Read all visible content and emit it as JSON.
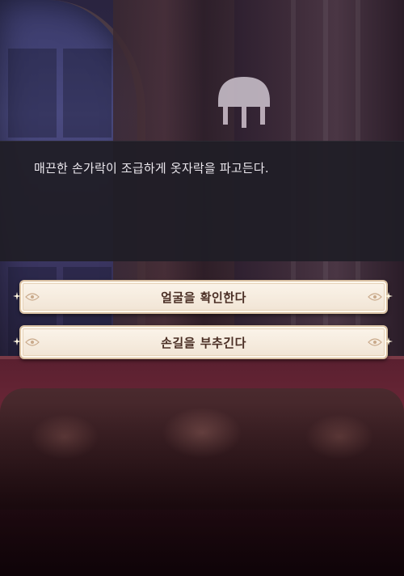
{
  "dialogue": {
    "text": "매끈한 손가락이 조급하게 옷자락을 파고든다."
  },
  "choices": [
    {
      "label": "얼굴을 확인한다"
    },
    {
      "label": "손길을 부추긴다"
    }
  ],
  "colors": {
    "dialogue_bg": "#201e26",
    "choice_bg": "#f6ecde",
    "choice_text": "#4a2e24",
    "choice_border": "#d9c1a3"
  }
}
